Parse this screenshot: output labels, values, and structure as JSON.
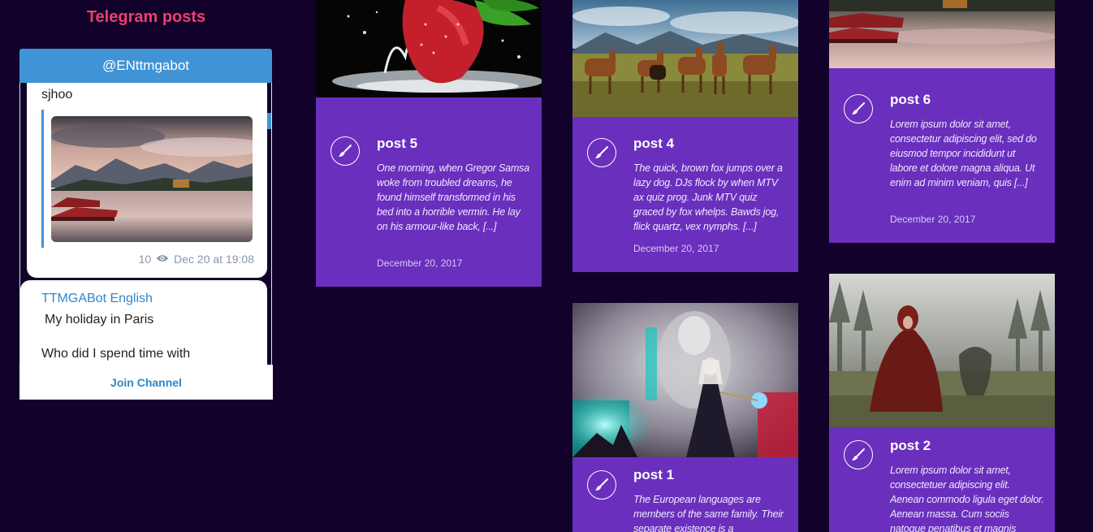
{
  "widget": {
    "title": "Telegram posts",
    "channel": "@ENttmgabot",
    "join_label": "Join Channel",
    "messages": [
      {
        "text": "sjhoo",
        "views": "10",
        "date": "Dec 20 at 19:08"
      },
      {
        "author": "TTMGABot English",
        "line1": "My holiday in Paris",
        "line2": "Who did I spend time with"
      }
    ]
  },
  "posts": [
    {
      "title": "post 5",
      "excerpt": "One morning, when Gregor Samsa woke from troubled dreams, he found himself transformed in his bed into a horrible vermin. He lay on his armour-like back, [...]",
      "date": "December 20, 2017"
    },
    {
      "title": "post 4",
      "excerpt": "The quick, brown fox jumps over a lazy dog. DJs flock by when MTV ax quiz prog. Junk MTV quiz graced by fox whelps. Bawds jog, flick quartz, vex nymphs. [...]",
      "date": "December 20, 2017"
    },
    {
      "title": "post 6",
      "excerpt": "Lorem ipsum dolor sit amet, consectetur adipiscing elit, sed do eiusmod tempor incididunt ut labore et dolore magna aliqua. Ut enim ad minim veniam, quis [...]",
      "date": "December 20, 2017"
    },
    {
      "title": "post 1",
      "excerpt": "The European languages are members of the same family. Their separate existence is a"
    },
    {
      "title": "post 2",
      "excerpt": "Lorem ipsum dolor sit amet, consectetuer adipiscing elit. Aenean commodo ligula eget dolor. Aenean massa. Cum sociis natoque penatibus et magnis"
    }
  ],
  "icons": {
    "eye": "eye-icon",
    "brush": "brush-icon"
  },
  "colors": {
    "background": "#12012b",
    "card": "#6a2fbd",
    "accent_title": "#ee3f6e",
    "telegram_blue": "#4094d6"
  }
}
